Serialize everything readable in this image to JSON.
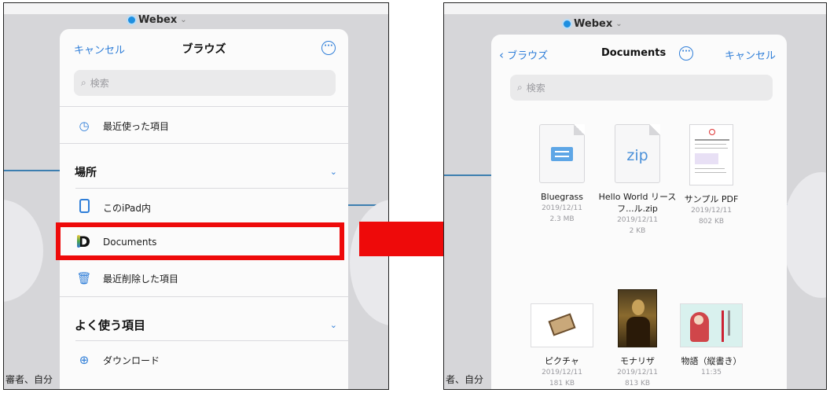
{
  "left_panel": {
    "app_switcher": "Webex",
    "nav": {
      "cancel": "キャンセル",
      "title": "ブラウズ"
    },
    "search_placeholder": "検索",
    "recents": "最近使った項目",
    "locations_header": "場所",
    "locations": [
      "このiPad内",
      "Documents",
      "最近削除した項目"
    ],
    "favorites_header": "よく使う項目",
    "favorites": [
      "ダウンロード"
    ],
    "background_text": "審者、自分"
  },
  "right_panel": {
    "app_switcher": "Webex",
    "nav": {
      "back": "ブラウズ",
      "title": "Documents",
      "cancel": "キャンセル"
    },
    "search_placeholder": "検索",
    "files": [
      {
        "name": "Bluegrass",
        "date": "2019/12/11",
        "size": "2.3 MB",
        "icon": "audio-file-icon"
      },
      {
        "name": "Hello World リースフ...ル.zip",
        "date": "2019/12/11",
        "size": "2 KB",
        "icon": "zip-file-icon"
      },
      {
        "name": "サンプル PDF",
        "date": "2019/12/11",
        "size": "802 KB",
        "icon": "pdf-file-icon"
      },
      {
        "name": "ピクチャ",
        "date": "2019/12/11",
        "size": "181 KB",
        "icon": "picture-file-icon"
      },
      {
        "name": "モナリザ",
        "date": "2019/12/11",
        "size": "813 KB",
        "icon": "mona-lisa-image"
      },
      {
        "name": "物語（縦書き）",
        "date": "11:35",
        "size": "",
        "icon": "story-document-icon"
      }
    ],
    "background_text": "者、自分"
  },
  "colors": {
    "accent": "#2f7ed8",
    "highlight": "#ee0a0a",
    "arrow": "#ee0a0a"
  }
}
